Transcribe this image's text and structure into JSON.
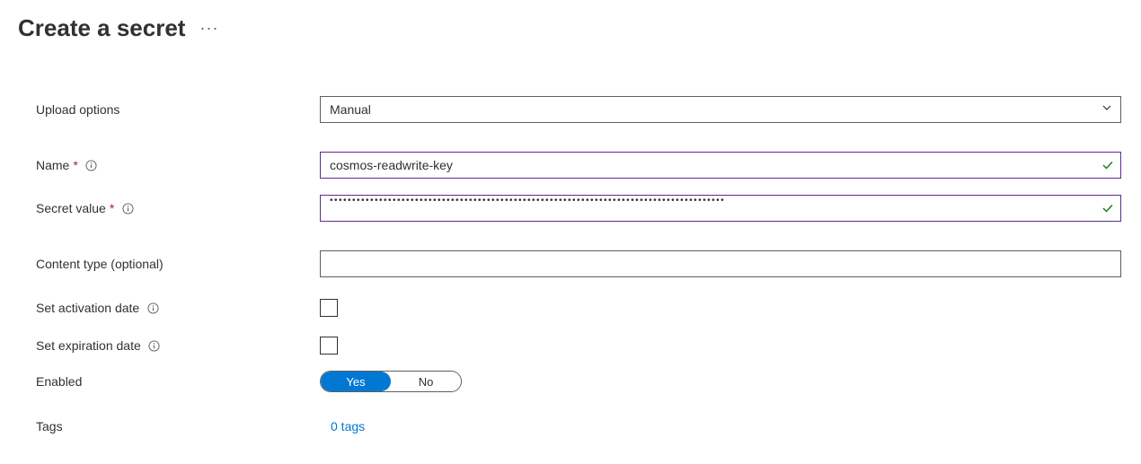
{
  "header": {
    "title": "Create a secret"
  },
  "form": {
    "upload_options": {
      "label": "Upload options",
      "value": "Manual"
    },
    "name": {
      "label": "Name",
      "value": "cosmos-readwrite-key"
    },
    "secret_value": {
      "label": "Secret value",
      "masked": "••••••••••••••••••••••••••••••••••••••••••••••••••••••••••••••••••••••••••••••••••••••••"
    },
    "content_type": {
      "label": "Content type (optional)",
      "value": ""
    },
    "activation": {
      "label": "Set activation date"
    },
    "expiration": {
      "label": "Set expiration date"
    },
    "enabled": {
      "label": "Enabled",
      "yes": "Yes",
      "no": "No"
    },
    "tags": {
      "label": "Tags",
      "link": "0 tags"
    }
  }
}
